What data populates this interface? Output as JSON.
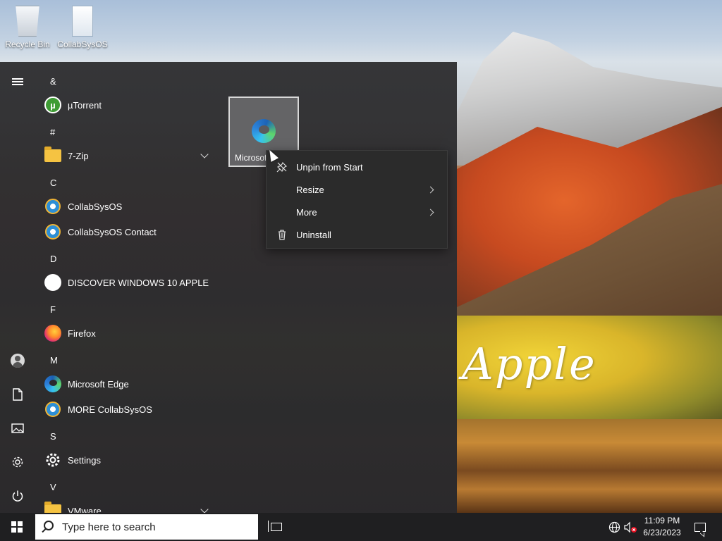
{
  "desktop": {
    "icons": [
      {
        "label": "Recycle Bin",
        "icon": "recycle-bin-icon"
      },
      {
        "label": "CollabSysOS",
        "icon": "document-icon"
      }
    ],
    "wallpaper_text": "Apple"
  },
  "start_menu": {
    "rail": {
      "expand_icon": "hamburger-icon",
      "user_icon": "user-icon",
      "documents_icon": "document-icon",
      "pictures_icon": "pictures-icon",
      "settings_icon": "gear-icon",
      "power_icon": "power-icon"
    },
    "letters": [
      "&",
      "#",
      "C",
      "D",
      "F",
      "M",
      "S",
      "V"
    ],
    "apps": [
      {
        "label": "µTorrent",
        "icon": "utorrent-icon"
      },
      {
        "label": "7-Zip",
        "icon": "folder-icon",
        "expandable": true
      },
      {
        "label": "CollabSysOS",
        "icon": "internet-explorer-icon"
      },
      {
        "label": "CollabSysOS Contact",
        "icon": "internet-explorer-icon"
      },
      {
        "label": "DISCOVER WINDOWS 10 APPLE",
        "icon": "apple-icon"
      },
      {
        "label": "Firefox",
        "icon": "firefox-icon"
      },
      {
        "label": "Microsoft Edge",
        "icon": "edge-icon"
      },
      {
        "label": "MORE CollabSysOS",
        "icon": "internet-explorer-icon"
      },
      {
        "label": "Settings",
        "icon": "gear-icon"
      },
      {
        "label": "VMware",
        "icon": "folder-icon",
        "expandable": true
      }
    ],
    "tile": {
      "label": "Microsoft Edge",
      "icon": "edge-icon"
    },
    "context_menu": [
      {
        "label": "Unpin from Start",
        "icon": "unpin-icon"
      },
      {
        "label": "Resize",
        "submenu": true
      },
      {
        "label": "More",
        "submenu": true
      },
      {
        "label": "Uninstall",
        "icon": "trash-icon"
      }
    ]
  },
  "taskbar": {
    "search_placeholder": "Type here to search",
    "time": "11:09 PM",
    "date": "6/23/2023",
    "tray_icons": [
      "network-icon",
      "volume-muted-icon",
      "notification-icon"
    ]
  }
}
